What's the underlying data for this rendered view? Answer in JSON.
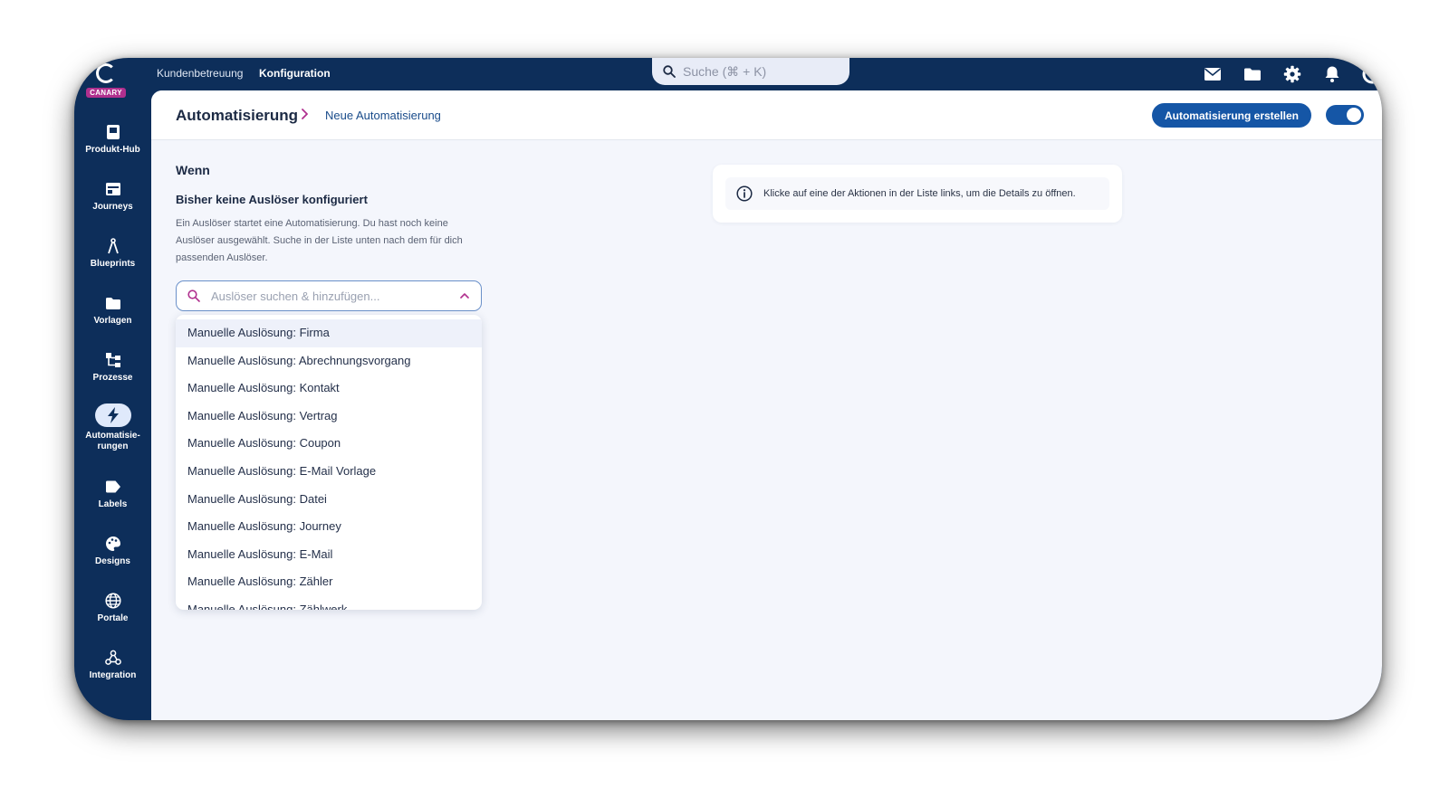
{
  "brand": {
    "badge": "CANARY",
    "primary_color": "#0d2e5a",
    "accent": "#1556a6",
    "badge_color": "#b0308e"
  },
  "topnav": {
    "links": [
      {
        "label": "Kundenbetreuung",
        "active": false
      },
      {
        "label": "Konfiguration",
        "active": true
      }
    ],
    "search": {
      "placeholder": "Suche (⌘ + K)",
      "icon": "search-icon"
    },
    "icons": [
      "mail-icon",
      "folder-icon",
      "gear-icon",
      "bell-icon",
      "avatar-icon"
    ]
  },
  "sidebar": {
    "items": [
      {
        "label": "Produkt-Hub",
        "icon": "book-icon",
        "active": false
      },
      {
        "label": "Journeys",
        "icon": "journey-icon",
        "active": false
      },
      {
        "label": "Blueprints",
        "icon": "compass-icon",
        "active": false
      },
      {
        "label": "Vorlagen",
        "icon": "folder-icon",
        "active": false
      },
      {
        "label": "Prozesse",
        "icon": "process-icon",
        "active": false
      },
      {
        "label": "Automatisie-\nrungen",
        "icon": "lightning-icon",
        "active": true
      },
      {
        "label": "Labels",
        "icon": "label-icon",
        "active": false
      },
      {
        "label": "Designs",
        "icon": "palette-icon",
        "active": false
      },
      {
        "label": "Portale",
        "icon": "globe-icon",
        "active": false
      },
      {
        "label": "Integration",
        "icon": "webhook-icon",
        "active": false
      }
    ]
  },
  "header": {
    "breadcrumb_root": "Automatisierung",
    "breadcrumb_current": "Neue Automatisierung",
    "create_button": "Automatisierung erstellen",
    "toggle_on": true
  },
  "trigger_section": {
    "title": "Wenn",
    "subtitle": "Bisher keine Auslöser konfiguriert",
    "description": "Ein Auslöser startet eine Automatisierung. Du hast noch keine Auslöser ausgewählt. Suche in der Liste unten nach dem für dich passenden Auslöser.",
    "search_placeholder": "Auslöser suchen & hinzufügen...",
    "options": [
      "Manuelle Auslösung: Firma",
      "Manuelle Auslösung: Abrechnungsvorgang",
      "Manuelle Auslösung: Kontakt",
      "Manuelle Auslösung: Vertrag",
      "Manuelle Auslösung: Coupon",
      "Manuelle Auslösung: E-Mail Vorlage",
      "Manuelle Auslösung: Datei",
      "Manuelle Auslösung: Journey",
      "Manuelle Auslösung: E-Mail",
      "Manuelle Auslösung: Zähler",
      "Manuelle Auslösung: Zählwerk"
    ]
  },
  "info_card": {
    "text": "Klicke auf eine der Aktionen in der Liste links, um die Details zu öffnen.",
    "icon": "info-icon"
  }
}
